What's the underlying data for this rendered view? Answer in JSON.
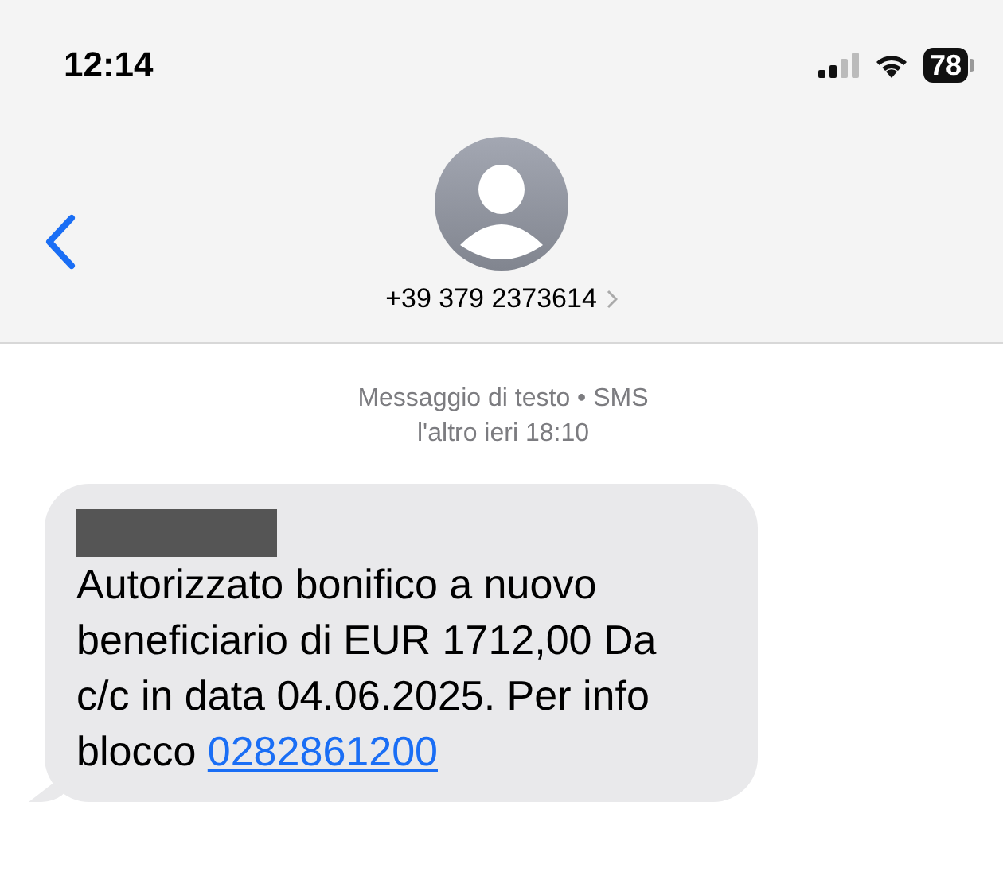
{
  "status_bar": {
    "time": "12:14",
    "battery": "78"
  },
  "header": {
    "contact": "+39 379 2373614"
  },
  "thread": {
    "service": "Messaggio di testo • SMS",
    "timestamp": "l'altro ieri 18:10"
  },
  "messages": [
    {
      "redacted": true,
      "text": "Autorizzato bonifico a nuovo beneficiario di EUR 1712,00 Da c/c in data 04.06.2025. Per info blocco ",
      "link": "0282861200"
    }
  ]
}
